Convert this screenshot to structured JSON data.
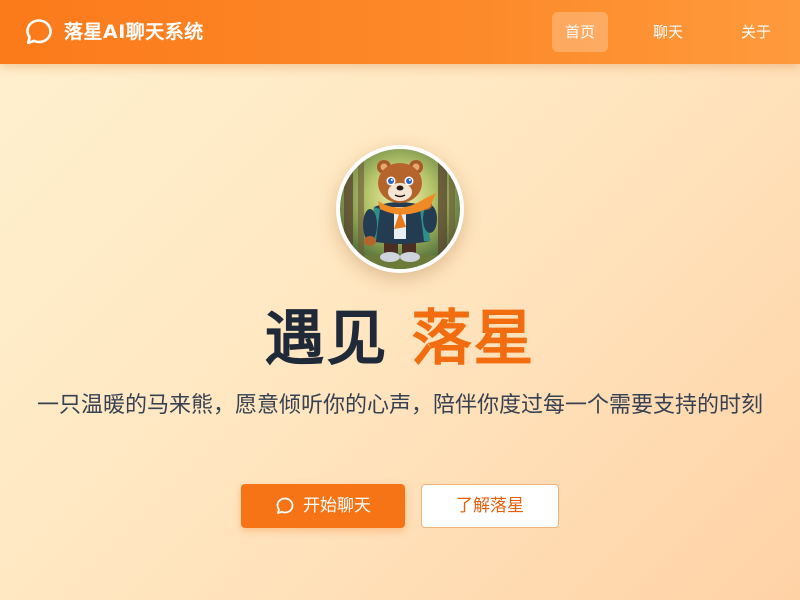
{
  "navbar": {
    "brand_title": "落星AI聊天系统",
    "brand_icon": "chat-bubble-icon",
    "items": [
      {
        "label": "首页",
        "active": true
      },
      {
        "label": "聊天",
        "active": false
      },
      {
        "label": "关于",
        "active": false
      }
    ]
  },
  "hero": {
    "avatar_alt": "bear-mascot-avatar",
    "headline_lead": "遇见",
    "headline_accent": "落星",
    "subtitle": "一只温暖的马来熊，愿意倾听你的心声，陪伴你度过每一个需要支持的时刻",
    "primary_button": {
      "label": "开始聊天",
      "icon": "chat-bubble-icon"
    },
    "secondary_button": {
      "label": "了解落星"
    }
  },
  "colors": {
    "navbar": "#fb7a1a",
    "accent": "#f26c10",
    "primary_button": "#f77416",
    "background": "#ffe6c0"
  }
}
